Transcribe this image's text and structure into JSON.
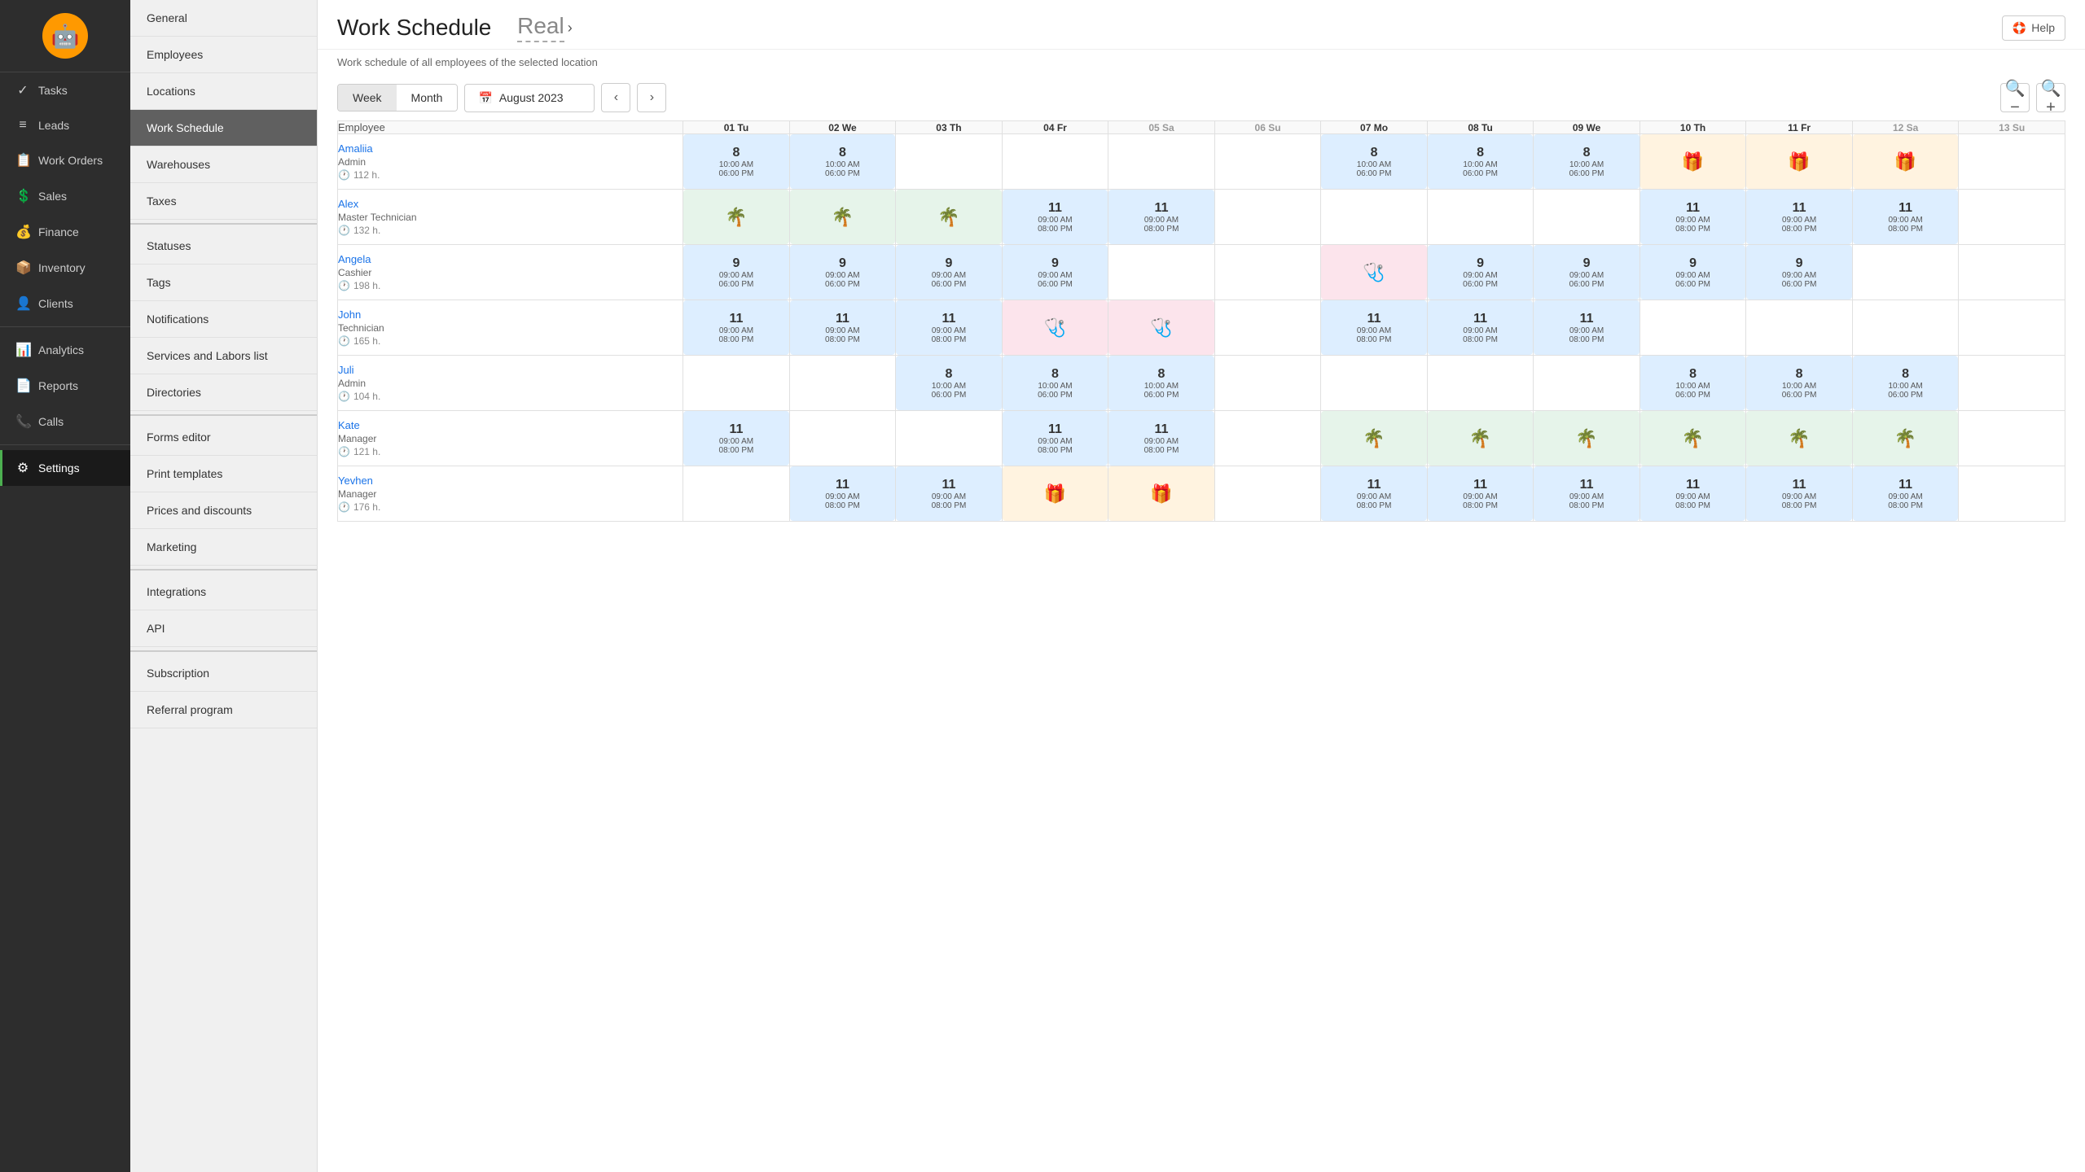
{
  "app": {
    "logo": "🤖",
    "help_label": "Help"
  },
  "left_nav": {
    "items": [
      {
        "id": "tasks",
        "label": "Tasks",
        "icon": "✓"
      },
      {
        "id": "leads",
        "label": "Leads",
        "icon": "≡"
      },
      {
        "id": "work-orders",
        "label": "Work Orders",
        "icon": "📋"
      },
      {
        "id": "sales",
        "label": "Sales",
        "icon": "💲"
      },
      {
        "id": "finance",
        "label": "Finance",
        "icon": "💰"
      },
      {
        "id": "inventory",
        "label": "Inventory",
        "icon": "📦"
      },
      {
        "id": "clients",
        "label": "Clients",
        "icon": "👤"
      },
      {
        "id": "analytics",
        "label": "Analytics",
        "icon": "📊"
      },
      {
        "id": "reports",
        "label": "Reports",
        "icon": "📄"
      },
      {
        "id": "calls",
        "label": "Calls",
        "icon": "📞"
      },
      {
        "id": "settings",
        "label": "Settings",
        "icon": "⚙"
      }
    ]
  },
  "sidebar": {
    "items": [
      {
        "id": "general",
        "label": "General"
      },
      {
        "id": "employees",
        "label": "Employees"
      },
      {
        "id": "locations",
        "label": "Locations"
      },
      {
        "id": "work-schedule",
        "label": "Work Schedule",
        "active": true
      },
      {
        "id": "warehouses",
        "label": "Warehouses"
      },
      {
        "id": "taxes",
        "label": "Taxes"
      },
      {
        "id": "statuses",
        "label": "Statuses"
      },
      {
        "id": "tags",
        "label": "Tags"
      },
      {
        "id": "notifications",
        "label": "Notifications"
      },
      {
        "id": "services-labors",
        "label": "Services and Labors list"
      },
      {
        "id": "directories",
        "label": "Directories"
      },
      {
        "id": "forms-editor",
        "label": "Forms editor"
      },
      {
        "id": "print-templates",
        "label": "Print templates"
      },
      {
        "id": "prices-discounts",
        "label": "Prices and discounts"
      },
      {
        "id": "marketing",
        "label": "Marketing"
      },
      {
        "id": "integrations",
        "label": "Integrations"
      },
      {
        "id": "api",
        "label": "API"
      },
      {
        "id": "subscription",
        "label": "Subscription"
      },
      {
        "id": "referral-program",
        "label": "Referral program"
      }
    ]
  },
  "main": {
    "title": "Work Schedule",
    "title_variant": "Real",
    "subtitle": "Work schedule of all employees of the selected location",
    "view_week": "Week",
    "view_month": "Month",
    "current_date": "August 2023",
    "zoom_out": "−",
    "zoom_in": "+",
    "column_employee": "Employee",
    "days": [
      {
        "label": "01 Tu",
        "weekend": false
      },
      {
        "label": "02 We",
        "weekend": false
      },
      {
        "label": "03 Th",
        "weekend": false
      },
      {
        "label": "04 Fr",
        "weekend": false
      },
      {
        "label": "05 Sa",
        "weekend": true
      },
      {
        "label": "06 Su",
        "weekend": true
      },
      {
        "label": "07 Mo",
        "weekend": false
      },
      {
        "label": "08 Tu",
        "weekend": false
      },
      {
        "label": "09 We",
        "weekend": false
      },
      {
        "label": "10 Th",
        "weekend": false
      },
      {
        "label": "11 Fr",
        "weekend": false
      },
      {
        "label": "12 Sa",
        "weekend": true
      },
      {
        "label": "13 Su",
        "weekend": true
      }
    ],
    "employees": [
      {
        "name": "Amaliia",
        "role": "Admin",
        "hours": "112 h.",
        "cells": [
          {
            "type": "schedule",
            "color": "blue",
            "num": "8",
            "time1": "10:00 AM",
            "time2": "06:00 PM"
          },
          {
            "type": "schedule",
            "color": "blue",
            "num": "8",
            "time1": "10:00 AM",
            "time2": "06:00 PM"
          },
          {
            "type": "empty"
          },
          {
            "type": "empty"
          },
          {
            "type": "empty"
          },
          {
            "type": "empty"
          },
          {
            "type": "schedule",
            "color": "blue",
            "num": "8",
            "time1": "10:00 AM",
            "time2": "06:00 PM"
          },
          {
            "type": "schedule",
            "color": "blue",
            "num": "8",
            "time1": "10:00 AM",
            "time2": "06:00 PM"
          },
          {
            "type": "schedule",
            "color": "blue",
            "num": "8",
            "time1": "10:00 AM",
            "time2": "06:00 PM"
          },
          {
            "type": "icon",
            "icon": "gift",
            "color": "orange"
          },
          {
            "type": "icon",
            "icon": "gift",
            "color": "orange"
          },
          {
            "type": "icon",
            "icon": "gift",
            "color": "orange"
          },
          {
            "type": "empty"
          }
        ]
      },
      {
        "name": "Alex",
        "role": "Master Technician",
        "hours": "132 h.",
        "cells": [
          {
            "type": "icon",
            "icon": "palm",
            "color": "green"
          },
          {
            "type": "icon",
            "icon": "palm",
            "color": "green"
          },
          {
            "type": "icon",
            "icon": "palm",
            "color": "green"
          },
          {
            "type": "schedule",
            "color": "blue",
            "num": "11",
            "time1": "09:00 AM",
            "time2": "08:00 PM"
          },
          {
            "type": "schedule",
            "color": "blue",
            "num": "11",
            "time1": "09:00 AM",
            "time2": "08:00 PM"
          },
          {
            "type": "empty"
          },
          {
            "type": "empty"
          },
          {
            "type": "empty"
          },
          {
            "type": "empty"
          },
          {
            "type": "schedule",
            "color": "blue",
            "num": "11",
            "time1": "09:00 AM",
            "time2": "08:00 PM"
          },
          {
            "type": "schedule",
            "color": "blue",
            "num": "11",
            "time1": "09:00 AM",
            "time2": "08:00 PM"
          },
          {
            "type": "schedule",
            "color": "blue",
            "num": "11",
            "time1": "09:00 AM",
            "time2": "08:00 PM"
          },
          {
            "type": "empty"
          }
        ]
      },
      {
        "name": "Angela",
        "role": "Cashier",
        "hours": "198 h.",
        "cells": [
          {
            "type": "schedule",
            "color": "blue",
            "num": "9",
            "time1": "09:00 AM",
            "time2": "06:00 PM"
          },
          {
            "type": "schedule",
            "color": "blue",
            "num": "9",
            "time1": "09:00 AM",
            "time2": "06:00 PM"
          },
          {
            "type": "schedule",
            "color": "blue",
            "num": "9",
            "time1": "09:00 AM",
            "time2": "06:00 PM"
          },
          {
            "type": "schedule",
            "color": "blue",
            "num": "9",
            "time1": "09:00 AM",
            "time2": "06:00 PM"
          },
          {
            "type": "empty"
          },
          {
            "type": "empty"
          },
          {
            "type": "icon",
            "icon": "medical",
            "color": "pink"
          },
          {
            "type": "schedule",
            "color": "blue",
            "num": "9",
            "time1": "09:00 AM",
            "time2": "06:00 PM"
          },
          {
            "type": "schedule",
            "color": "blue",
            "num": "9",
            "time1": "09:00 AM",
            "time2": "06:00 PM"
          },
          {
            "type": "schedule",
            "color": "blue",
            "num": "9",
            "time1": "09:00 AM",
            "time2": "06:00 PM"
          },
          {
            "type": "schedule",
            "color": "blue",
            "num": "9",
            "time1": "09:00 AM",
            "time2": "06:00 PM"
          },
          {
            "type": "empty"
          },
          {
            "type": "empty"
          }
        ]
      },
      {
        "name": "John",
        "role": "Technician",
        "hours": "165 h.",
        "cells": [
          {
            "type": "schedule",
            "color": "blue",
            "num": "11",
            "time1": "09:00 AM",
            "time2": "08:00 PM"
          },
          {
            "type": "schedule",
            "color": "blue",
            "num": "11",
            "time1": "09:00 AM",
            "time2": "08:00 PM"
          },
          {
            "type": "schedule",
            "color": "blue",
            "num": "11",
            "time1": "09:00 AM",
            "time2": "08:00 PM"
          },
          {
            "type": "icon",
            "icon": "medical",
            "color": "pink"
          },
          {
            "type": "icon",
            "icon": "medical",
            "color": "pink"
          },
          {
            "type": "empty"
          },
          {
            "type": "schedule",
            "color": "blue",
            "num": "11",
            "time1": "09:00 AM",
            "time2": "08:00 PM"
          },
          {
            "type": "schedule",
            "color": "blue",
            "num": "11",
            "time1": "09:00 AM",
            "time2": "08:00 PM"
          },
          {
            "type": "schedule",
            "color": "blue",
            "num": "11",
            "time1": "09:00 AM",
            "time2": "08:00 PM"
          },
          {
            "type": "empty"
          },
          {
            "type": "empty"
          },
          {
            "type": "empty"
          },
          {
            "type": "empty"
          }
        ]
      },
      {
        "name": "Juli",
        "role": "Admin",
        "hours": "104 h.",
        "cells": [
          {
            "type": "empty"
          },
          {
            "type": "empty"
          },
          {
            "type": "schedule",
            "color": "blue",
            "num": "8",
            "time1": "10:00 AM",
            "time2": "06:00 PM"
          },
          {
            "type": "schedule",
            "color": "blue",
            "num": "8",
            "time1": "10:00 AM",
            "time2": "06:00 PM"
          },
          {
            "type": "schedule",
            "color": "blue",
            "num": "8",
            "time1": "10:00 AM",
            "time2": "06:00 PM"
          },
          {
            "type": "empty"
          },
          {
            "type": "empty"
          },
          {
            "type": "empty"
          },
          {
            "type": "empty"
          },
          {
            "type": "schedule",
            "color": "blue",
            "num": "8",
            "time1": "10:00 AM",
            "time2": "06:00 PM"
          },
          {
            "type": "schedule",
            "color": "blue",
            "num": "8",
            "time1": "10:00 AM",
            "time2": "06:00 PM"
          },
          {
            "type": "schedule",
            "color": "blue",
            "num": "8",
            "time1": "10:00 AM",
            "time2": "06:00 PM"
          },
          {
            "type": "empty"
          }
        ]
      },
      {
        "name": "Kate",
        "role": "Manager",
        "hours": "121 h.",
        "cells": [
          {
            "type": "schedule",
            "color": "blue",
            "num": "11",
            "time1": "09:00 AM",
            "time2": "08:00 PM"
          },
          {
            "type": "empty"
          },
          {
            "type": "empty"
          },
          {
            "type": "schedule",
            "color": "blue",
            "num": "11",
            "time1": "09:00 AM",
            "time2": "08:00 PM"
          },
          {
            "type": "schedule",
            "color": "blue",
            "num": "11",
            "time1": "09:00 AM",
            "time2": "08:00 PM"
          },
          {
            "type": "empty"
          },
          {
            "type": "icon",
            "icon": "palm",
            "color": "green"
          },
          {
            "type": "icon",
            "icon": "palm",
            "color": "green"
          },
          {
            "type": "icon",
            "icon": "palm",
            "color": "green"
          },
          {
            "type": "icon",
            "icon": "palm",
            "color": "green"
          },
          {
            "type": "icon",
            "icon": "palm",
            "color": "green"
          },
          {
            "type": "icon",
            "icon": "palm",
            "color": "green"
          },
          {
            "type": "empty"
          }
        ]
      },
      {
        "name": "Yevhen",
        "role": "Manager",
        "hours": "176 h.",
        "cells": [
          {
            "type": "empty"
          },
          {
            "type": "schedule",
            "color": "blue",
            "num": "11",
            "time1": "09:00 AM",
            "time2": "08:00 PM"
          },
          {
            "type": "schedule",
            "color": "blue",
            "num": "11",
            "time1": "09:00 AM",
            "time2": "08:00 PM"
          },
          {
            "type": "icon",
            "icon": "gift",
            "color": "orange"
          },
          {
            "type": "icon",
            "icon": "gift",
            "color": "orange"
          },
          {
            "type": "empty"
          },
          {
            "type": "schedule",
            "color": "blue",
            "num": "11",
            "time1": "09:00 AM",
            "time2": "08:00 PM"
          },
          {
            "type": "schedule",
            "color": "blue",
            "num": "11",
            "time1": "09:00 AM",
            "time2": "08:00 PM"
          },
          {
            "type": "schedule",
            "color": "blue",
            "num": "11",
            "time1": "09:00 AM",
            "time2": "08:00 PM"
          },
          {
            "type": "schedule",
            "color": "blue",
            "num": "11",
            "time1": "09:00 AM",
            "time2": "08:00 PM"
          },
          {
            "type": "schedule",
            "color": "blue",
            "num": "11",
            "time1": "09:00 AM",
            "time2": "08:00 PM"
          },
          {
            "type": "schedule",
            "color": "blue",
            "num": "11",
            "time1": "09:00 AM",
            "time2": "08:00 PM"
          },
          {
            "type": "empty"
          }
        ]
      }
    ]
  }
}
